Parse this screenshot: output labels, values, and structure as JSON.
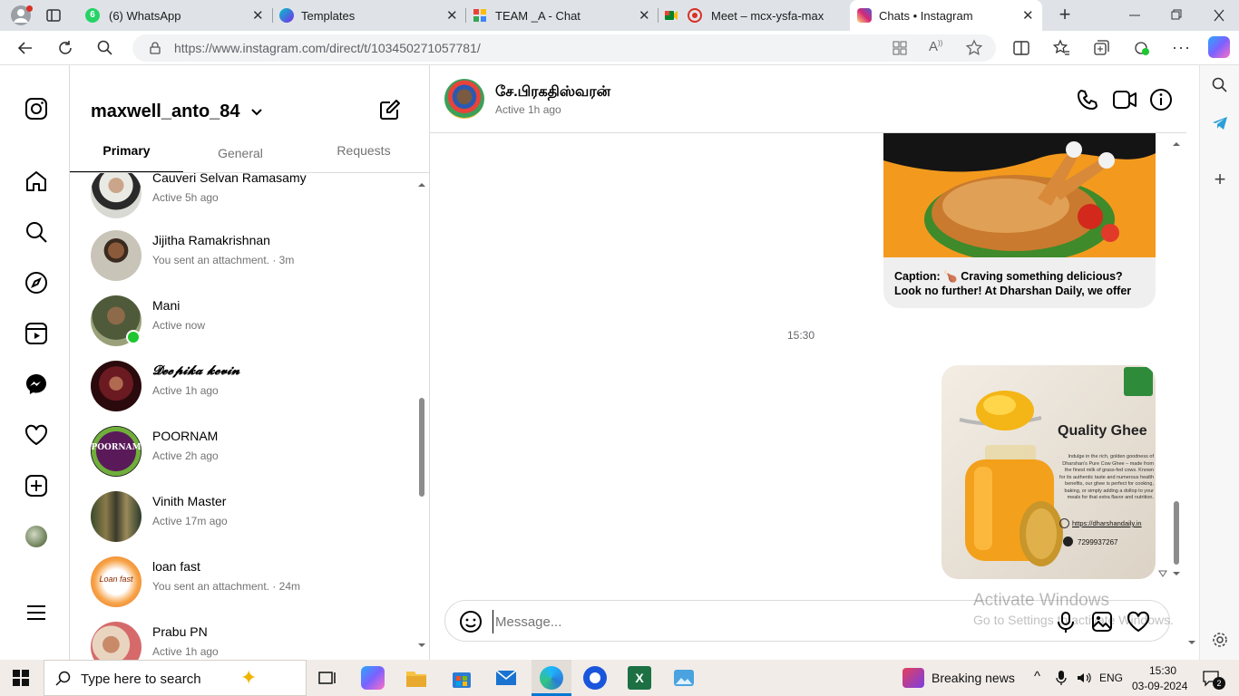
{
  "browser": {
    "tabs": [
      {
        "title": "(6) WhatsApp",
        "badge": "6"
      },
      {
        "title": "Templates"
      },
      {
        "title": "TEAM _A - Chat"
      },
      {
        "title": "Meet – mcx-ysfa-max"
      },
      {
        "title": "Chats • Instagram"
      }
    ],
    "url": "https://www.instagram.com/direct/t/103450271057781/"
  },
  "inbox": {
    "username": "maxwell_anto_84",
    "tabs": [
      "Primary",
      "General",
      "Requests"
    ],
    "active_tab": "Primary",
    "conversations": [
      {
        "name": "Cauveri Selvan Ramasamy",
        "subtitle": "Active 5h ago"
      },
      {
        "name": "Jijitha Ramakrishnan",
        "subtitle": "You sent an attachment. · 3m"
      },
      {
        "name": "Mani",
        "subtitle": "Active now",
        "online": true
      },
      {
        "name": "𝓓𝓮𝓮𝓹𝓲𝓴𝓪 𝓴𝓮𝓿𝓲𝓷",
        "subtitle": "Active 1h ago"
      },
      {
        "name": "POORNAM",
        "subtitle": "Active 2h ago",
        "avatar_text": "POORNAM"
      },
      {
        "name": "Vinith Master",
        "subtitle": "Active 17m ago"
      },
      {
        "name": "loan fast",
        "subtitle": "You sent an attachment. · 24m",
        "avatar_text": "Loan fast"
      },
      {
        "name": "Prabu PN",
        "subtitle": "Active 1h ago"
      }
    ]
  },
  "chat": {
    "contact_name": "சே.பிரகதிஸ்வரன்",
    "contact_status": "Active 1h ago",
    "caption_text": "Caption: 🍗 Craving something delicious? Look no further! At Dharshan Daily, we offer the freshest...",
    "timestamp": "15:30",
    "ghee_card": {
      "title": "Quality Ghee",
      "body": "Indulge in the rich, golden goodness of Dharshan's Pure Cow Ghee – made from the finest milk of grass-fed cows. Known for its authentic taste and numerous health benefits, our ghee is perfect for cooking, baking, or simply adding a dollop to your meals for that extra flavor and nutrition.",
      "website": "https://dharshandaily.in",
      "phone": "7299937267"
    },
    "message_placeholder": "Message...",
    "watermark_line1": "Activate Windows",
    "watermark_line2": "Go to Settings to activate Windows."
  },
  "taskbar": {
    "search_placeholder": "Type here to search",
    "news": "Breaking news",
    "language": "ENG",
    "time": "15:30",
    "date": "03-09-2024",
    "notifications": "2"
  },
  "colors": {
    "accent": "#0095f6",
    "online": "#1ec630",
    "taskbar": "#f1ece8",
    "tabstrip": "#dfe3e8"
  }
}
